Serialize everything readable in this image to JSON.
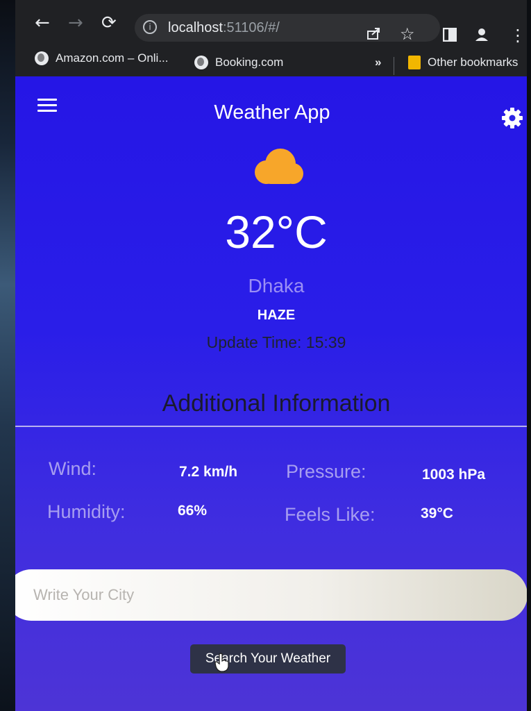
{
  "browser": {
    "url_host": "localhost",
    "url_rest": ":51106/#/",
    "bookmarks": [
      {
        "label": "Amazon.com – Onli..."
      },
      {
        "label": "Booking.com"
      }
    ],
    "overflow_label": "»",
    "other_bookmarks": "Other bookmarks",
    "icons": {
      "back": "←",
      "forward": "→",
      "reload": "⟳",
      "share": "share-icon",
      "star": "☆",
      "sidepanel": "sidepanel-icon",
      "profile": "profile-icon",
      "menu": "⋮"
    }
  },
  "app": {
    "title": "Weather App",
    "temperature": "32°C",
    "city": "Dhaka",
    "condition": "HAZE",
    "update_time": "Update Time: 15:39",
    "additional_title": "Additional Information",
    "info": {
      "wind_label": "Wind:",
      "wind_value": "7.2 km/h",
      "pressure_label": "Pressure:",
      "pressure_value": "1003 hPa",
      "humidity_label": "Humidity:",
      "humidity_value": "66%",
      "feels_label": "Feels Like:",
      "feels_value": "39°C"
    },
    "search_placeholder": "Write Your City",
    "search_button": "Search Your Weather",
    "colors": {
      "background": "#2a1ee8",
      "cloud": "#f7a62a",
      "button": "#2e3247"
    }
  }
}
